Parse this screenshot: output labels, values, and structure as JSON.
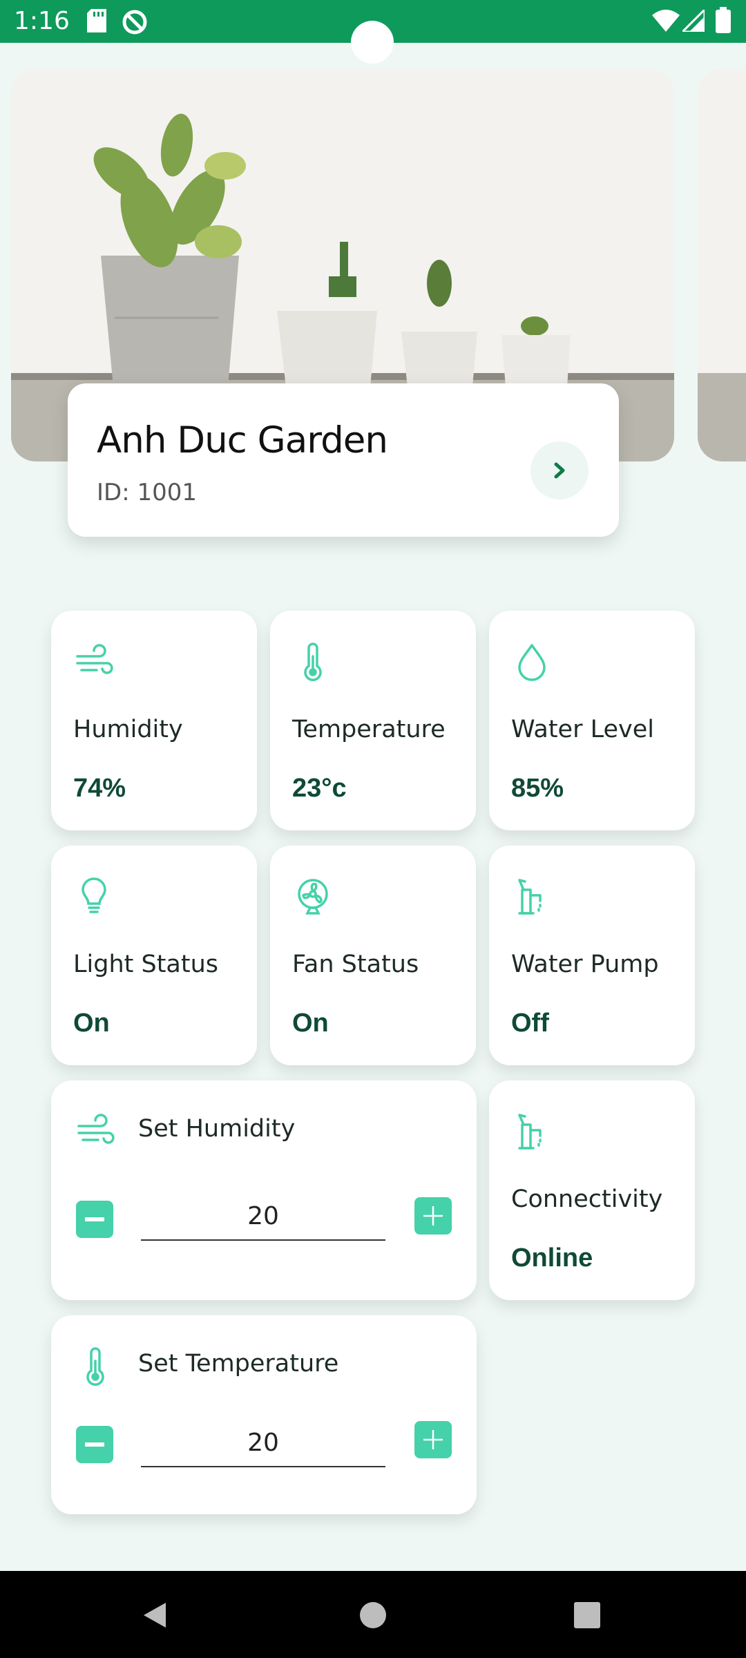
{
  "status_bar": {
    "time": "1:16",
    "icons": [
      "sd-card-icon",
      "at-sign-icon",
      "wifi-icon",
      "cellular-signal-icon",
      "battery-icon"
    ]
  },
  "garden": {
    "name": "Anh Duc Garden",
    "id_label": "ID: 1001",
    "image": "potted-plants-photo"
  },
  "sensors": [
    {
      "label": "Humidity",
      "value": "74%",
      "icon": "wind-icon"
    },
    {
      "label": "Temperature",
      "value": "23°c",
      "icon": "thermometer-icon"
    },
    {
      "label": "Water Level",
      "value": "85%",
      "icon": "water-drop-icon"
    },
    {
      "label": "Light Status",
      "value": "On",
      "icon": "lightbulb-icon"
    },
    {
      "label": "Fan Status",
      "value": "On",
      "icon": "fan-icon"
    },
    {
      "label": "Water Pump",
      "value": "Off",
      "icon": "water-pump-icon"
    }
  ],
  "connectivity": {
    "label": "Connectivity",
    "value": "Online",
    "icon": "water-pump-icon"
  },
  "set_humidity": {
    "label": "Set Humidity",
    "value": "20",
    "icon": "wind-icon"
  },
  "set_temperature": {
    "label": "Set Temperature",
    "value": "20",
    "icon": "thermometer-icon"
  },
  "colors": {
    "accent": "#45d1a9",
    "status_bar": "#0e9a5b",
    "value_text": "#0f4a36",
    "background": "#eef7f4"
  }
}
